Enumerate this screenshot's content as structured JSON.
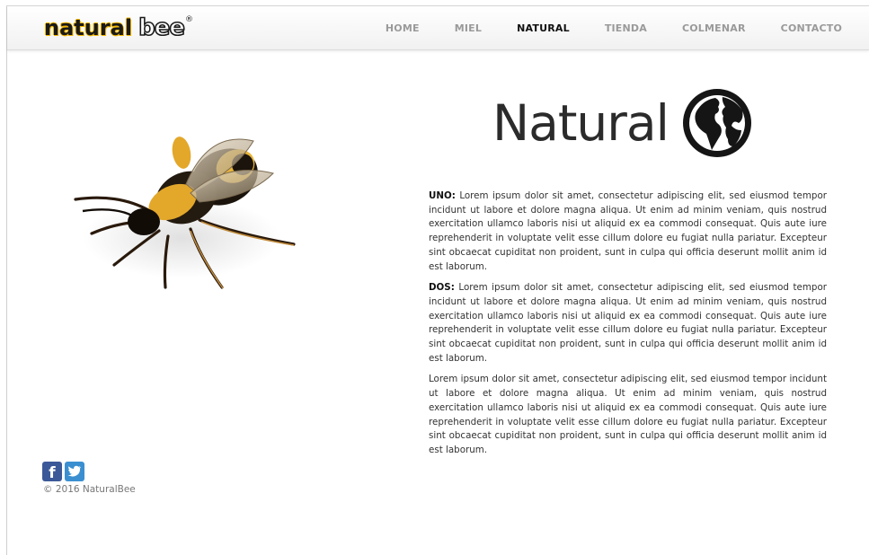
{
  "brand": {
    "logo_natural": "natural",
    "logo_bee": "bee",
    "logo_reg": "®",
    "colors": {
      "accent": "#f5b800",
      "text_dark": "#1a1a1a",
      "nav_inactive": "#9a9a9a"
    }
  },
  "nav": {
    "items": [
      {
        "label": "HOME"
      },
      {
        "label": "MIEL"
      },
      {
        "label": "NATURAL"
      },
      {
        "label": "TIENDA"
      },
      {
        "label": "COLMENAR"
      },
      {
        "label": "CONTACTO"
      }
    ],
    "active": "NATURAL"
  },
  "main": {
    "image": {
      "icon": "bee-image"
    },
    "title": "Natural",
    "title_icon": "globe-icon",
    "paragraphs": [
      {
        "lead": "UNO:",
        "text": " Lorem ipsum dolor sit amet, consectetur adipiscing elit, sed eiusmod tempor incidunt ut labore et dolore magna aliqua. Ut enim ad minim veniam, quis nostrud exercitation ullamco laboris nisi ut aliquid ex ea commodi consequat. Quis aute iure reprehenderit in voluptate velit esse cillum dolore eu fugiat nulla pariatur. Excepteur sint obcaecat cupiditat non proident, sunt in culpa qui officia deserunt mollit anim id est laborum."
      },
      {
        "lead": "DOS:",
        "text": " Lorem ipsum dolor sit amet, consectetur adipiscing elit, sed eiusmod tempor incidunt ut labore et dolore magna aliqua. Ut enim ad minim veniam, quis nostrud exercitation ullamco laboris nisi ut aliquid ex ea commodi consequat. Quis aute iure reprehenderit in voluptate velit esse cillum dolore eu fugiat nulla pariatur. Excepteur sint obcaecat cupiditat non proident, sunt in culpa qui officia deserunt mollit anim id est laborum."
      },
      {
        "lead": "",
        "text": "Lorem ipsum dolor sit amet, consectetur adipiscing elit, sed eiusmod tempor incidunt ut labore et dolore magna aliqua. Ut enim ad minim veniam, quis nostrud exercitation ullamco laboris nisi ut aliquid ex ea commodi consequat. Quis aute iure reprehenderit in voluptate velit esse cillum dolore eu fugiat nulla pariatur. Excepteur sint obcaecat cupiditat non proident, sunt in culpa qui officia deserunt mollit anim id est laborum."
      }
    ]
  },
  "footer": {
    "social": [
      {
        "icon": "facebook-icon",
        "glyph": "f",
        "color": "#3b5998"
      },
      {
        "icon": "twitter-icon",
        "color": "#3a8fd0"
      }
    ],
    "copyright": "© 2016 NaturalBee"
  }
}
